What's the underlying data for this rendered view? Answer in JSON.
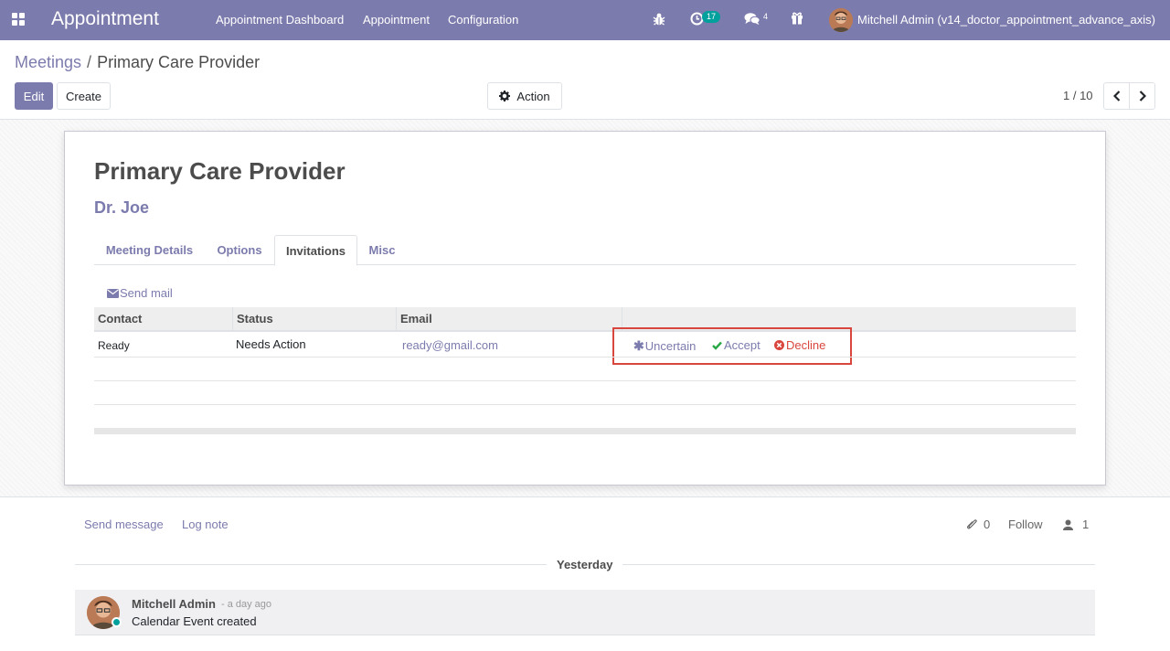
{
  "navbar": {
    "brand": "Appointment",
    "menu": [
      "Appointment Dashboard",
      "Appointment",
      "Configuration"
    ],
    "activity_count": "17",
    "messages_count": "4",
    "user_name": "Mitchell Admin (v14_doctor_appointment_advance_axis)",
    "bg_color": "#7c7bad"
  },
  "breadcrumb": {
    "parent": "Meetings",
    "separator": "/",
    "current": "Primary Care Provider"
  },
  "control_panel": {
    "edit_label": "Edit",
    "create_label": "Create",
    "action_label": "Action",
    "pager": "1 / 10"
  },
  "form": {
    "title": "Primary Care Provider",
    "subtitle": "Dr. Joe",
    "tabs": [
      {
        "label": "Meeting Details",
        "active": false
      },
      {
        "label": "Options",
        "active": false
      },
      {
        "label": "Invitations",
        "active": true
      },
      {
        "label": "Misc",
        "active": false
      }
    ],
    "send_mail_label": "Send mail",
    "attendee_table": {
      "columns": [
        "Contact",
        "Status",
        "Email"
      ],
      "rows": [
        {
          "contact": "Ready",
          "status": "Needs Action",
          "email": "ready@gmail.com",
          "actions": {
            "uncertain": "Uncertain",
            "accept": "Accept",
            "decline": "Decline"
          }
        }
      ]
    }
  },
  "chatter": {
    "send_message": "Send message",
    "log_note": "Log note",
    "attachments_count": "0",
    "follow_label": "Follow",
    "followers_count": "1",
    "date_separator": "Yesterday",
    "messages": [
      {
        "author": "Mitchell Admin",
        "date": "- a day ago",
        "body": "Calendar Event created"
      }
    ]
  },
  "colors": {
    "primary": "#7c7bad",
    "accept": "#28a745",
    "decline": "#d9463e",
    "highlight_border": "#d9463e"
  }
}
